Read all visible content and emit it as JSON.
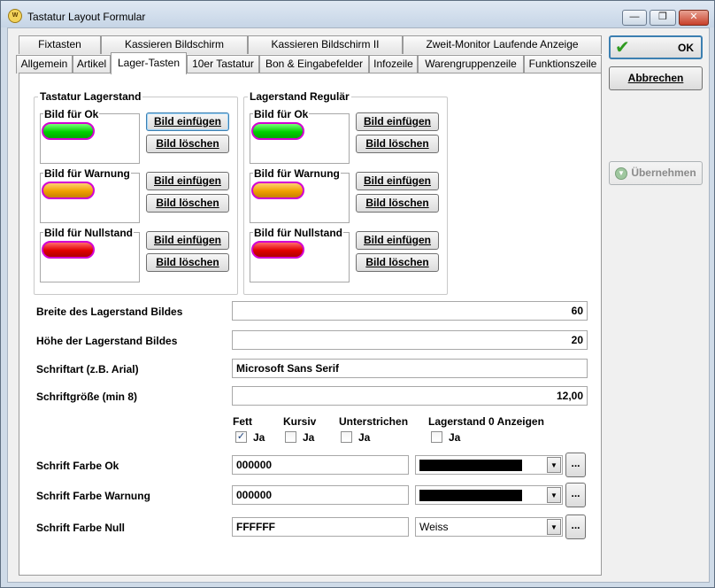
{
  "window": {
    "title": "Tastatur Layout Formular",
    "app_icon_text": "W",
    "controls": {
      "minimize": "—",
      "maximize": "❐",
      "close": "✕"
    }
  },
  "tabs_row1": [
    "Fixtasten",
    "Kassieren Bildschirm",
    "Kassieren Bildschirm II",
    "Zweit-Monitor Laufende Anzeige"
  ],
  "tabs_row2": [
    "Allgemein",
    "Artikel",
    "Lager-Tasten",
    "10er Tastatur",
    "Bon & Eingabefelder",
    "Infozeile",
    "Warengruppenzeile",
    "Funktionszeile"
  ],
  "active_tab": "Lager-Tasten",
  "groups": {
    "tastatur": {
      "title": "Tastatur Lagerstand",
      "items": [
        {
          "label": "Bild für Ok",
          "color": "#00d000",
          "insert": "Bild einfügen",
          "delete": "Bild löschen"
        },
        {
          "label": "Bild für Warnung",
          "color": "#f0a000",
          "insert": "Bild einfügen",
          "delete": "Bild löschen"
        },
        {
          "label": "Bild für Nullstand",
          "color": "#e00000",
          "insert": "Bild einfügen",
          "delete": "Bild löschen"
        }
      ]
    },
    "regular": {
      "title": "Lagerstand Regulär",
      "items": [
        {
          "label": "Bild für Ok",
          "color": "#00d000",
          "insert": "Bild einfügen",
          "delete": "Bild löschen"
        },
        {
          "label": "Bild für Warnung",
          "color": "#f0a000",
          "insert": "Bild einfügen",
          "delete": "Bild löschen"
        },
        {
          "label": "Bild für Nullstand",
          "color": "#e00000",
          "insert": "Bild einfügen",
          "delete": "Bild löschen"
        }
      ]
    }
  },
  "fields": {
    "breite": {
      "label": "Breite des Lagerstand Bildes",
      "value": "60"
    },
    "hoehe": {
      "label": "Höhe der Lagerstand Bildes",
      "value": "20"
    },
    "schriftart": {
      "label": "Schriftart (z.B. Arial)",
      "value": "Microsoft Sans Serif"
    },
    "schriftgroesse": {
      "label": "Schriftgröße (min 8)",
      "value": "12,00"
    }
  },
  "style_options": [
    {
      "label": "Fett",
      "check_label": "Ja",
      "checked": true
    },
    {
      "label": "Kursiv",
      "check_label": "Ja",
      "checked": false
    },
    {
      "label": "Unterstrichen",
      "check_label": "Ja",
      "checked": false
    },
    {
      "label": "Lagerstand 0 Anzeigen",
      "check_label": "Ja",
      "checked": false
    }
  ],
  "colors": {
    "ok": {
      "label": "Schrift Farbe Ok",
      "value": "000000",
      "combo_text": "",
      "swatch": "#000000"
    },
    "warnung": {
      "label": "Schrift Farbe Warnung",
      "value": "000000",
      "combo_text": "",
      "swatch": "#000000"
    },
    "null": {
      "label": "Schrift Farbe Null",
      "value": "FFFFFF",
      "combo_text": "Weiss",
      "swatch": "#ffffff"
    },
    "ellipsis": "..."
  },
  "buttons": {
    "ok": "OK",
    "cancel": "Abbrechen",
    "apply": "Übernehmen"
  },
  "icons": {
    "ok": "check-icon",
    "apply": "apply-icon",
    "dropdown": "chevron-down-icon"
  }
}
